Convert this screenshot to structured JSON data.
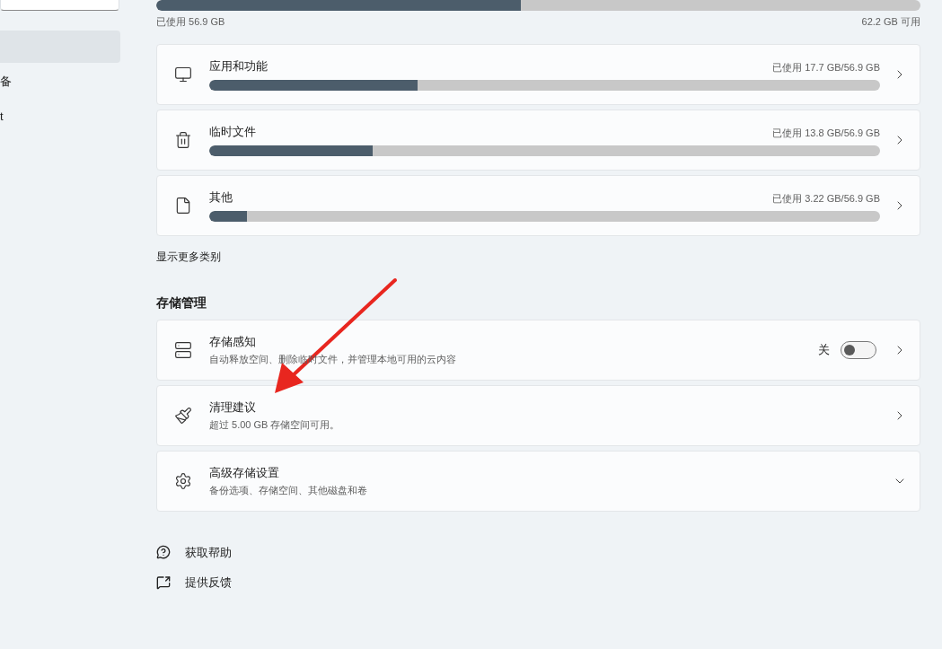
{
  "sidebar": {
    "items": [
      {
        "selected": true
      },
      {
        "label": "备",
        "selected": false
      },
      {
        "label": "t",
        "selected": false
      }
    ]
  },
  "overall": {
    "level": 0.477,
    "used": "已使用 56.9 GB",
    "free": "62.2 GB 可用"
  },
  "categories": [
    {
      "name": "应用和功能",
      "usage": "已使用 17.7 GB/56.9 GB",
      "level": 0.311
    },
    {
      "name": "临时文件",
      "usage": "已使用 13.8 GB/56.9 GB",
      "level": 0.243
    },
    {
      "name": "其他",
      "usage": "已使用 3.22 GB/56.9 GB",
      "level": 0.056
    }
  ],
  "show_more": "显示更多类别",
  "management": {
    "title": "存储管理",
    "items": [
      {
        "kind": "link",
        "title": "存储感知",
        "subtitle": "自动释放空间、删除临时文件，并管理本地可用的云内容",
        "toggle": {
          "label": "关",
          "on": false
        }
      },
      {
        "kind": "link",
        "title": "清理建议",
        "subtitle": "超过 5.00 GB 存储空间可用。"
      },
      {
        "kind": "expander",
        "title": "高级存储设置",
        "subtitle": "备份选项、存储空间、其他磁盘和卷",
        "expanded": false
      }
    ]
  },
  "help_links": [
    "获取帮助",
    "提供反馈"
  ]
}
